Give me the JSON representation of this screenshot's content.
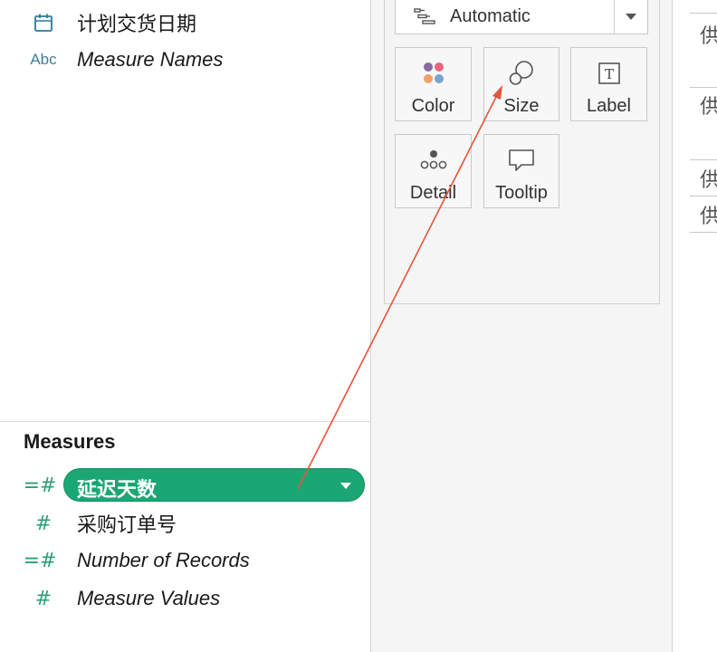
{
  "dimensions": {
    "fields": [
      {
        "label": "计划交货日期",
        "icon": "calendar-icon",
        "italic": false
      },
      {
        "label": "Measure Names",
        "icon": "abc-text-icon",
        "icon_text": "Abc",
        "italic": true
      }
    ]
  },
  "measures": {
    "heading": "Measures",
    "fields": [
      {
        "label": "延迟天数",
        "icon": "calculated-measure-icon",
        "icon_text": "=#",
        "italic": false,
        "selected": true
      },
      {
        "label": "采购订单号",
        "icon": "measure-icon",
        "icon_text": "#",
        "italic": false,
        "selected": false
      },
      {
        "label": "Number of Records",
        "icon": "calculated-measure-icon",
        "icon_text": "=#",
        "italic": true,
        "selected": false
      },
      {
        "label": "Measure Values",
        "icon": "measure-icon",
        "icon_text": "#",
        "italic": true,
        "selected": false
      }
    ]
  },
  "marks_card": {
    "mark_type": "Automatic",
    "buttons": [
      {
        "label": "Color",
        "icon": "color-dots-icon"
      },
      {
        "label": "Size",
        "icon": "size-circles-icon"
      },
      {
        "label": "Label",
        "icon": "label-text-icon"
      },
      {
        "label": "Detail",
        "icon": "detail-dots-icon"
      },
      {
        "label": "Tooltip",
        "icon": "tooltip-bubble-icon"
      }
    ]
  },
  "view_cells": [
    "供",
    "供",
    "供",
    "供"
  ],
  "colors": {
    "pill_green": "#1aa773",
    "measure_icon_green": "#2e9e77",
    "dimension_icon_blue": "#2b7a99",
    "annotation_arrow": "#e8533c",
    "color_dot_purple": "#8a6aa0",
    "color_dot_pink": "#e9657e",
    "color_dot_orange": "#f0a26b",
    "color_dot_blue": "#7aa3cf"
  },
  "annotation": {
    "type": "drag-arrow",
    "from": "measure-pill-delay-days",
    "to": "size-button"
  }
}
